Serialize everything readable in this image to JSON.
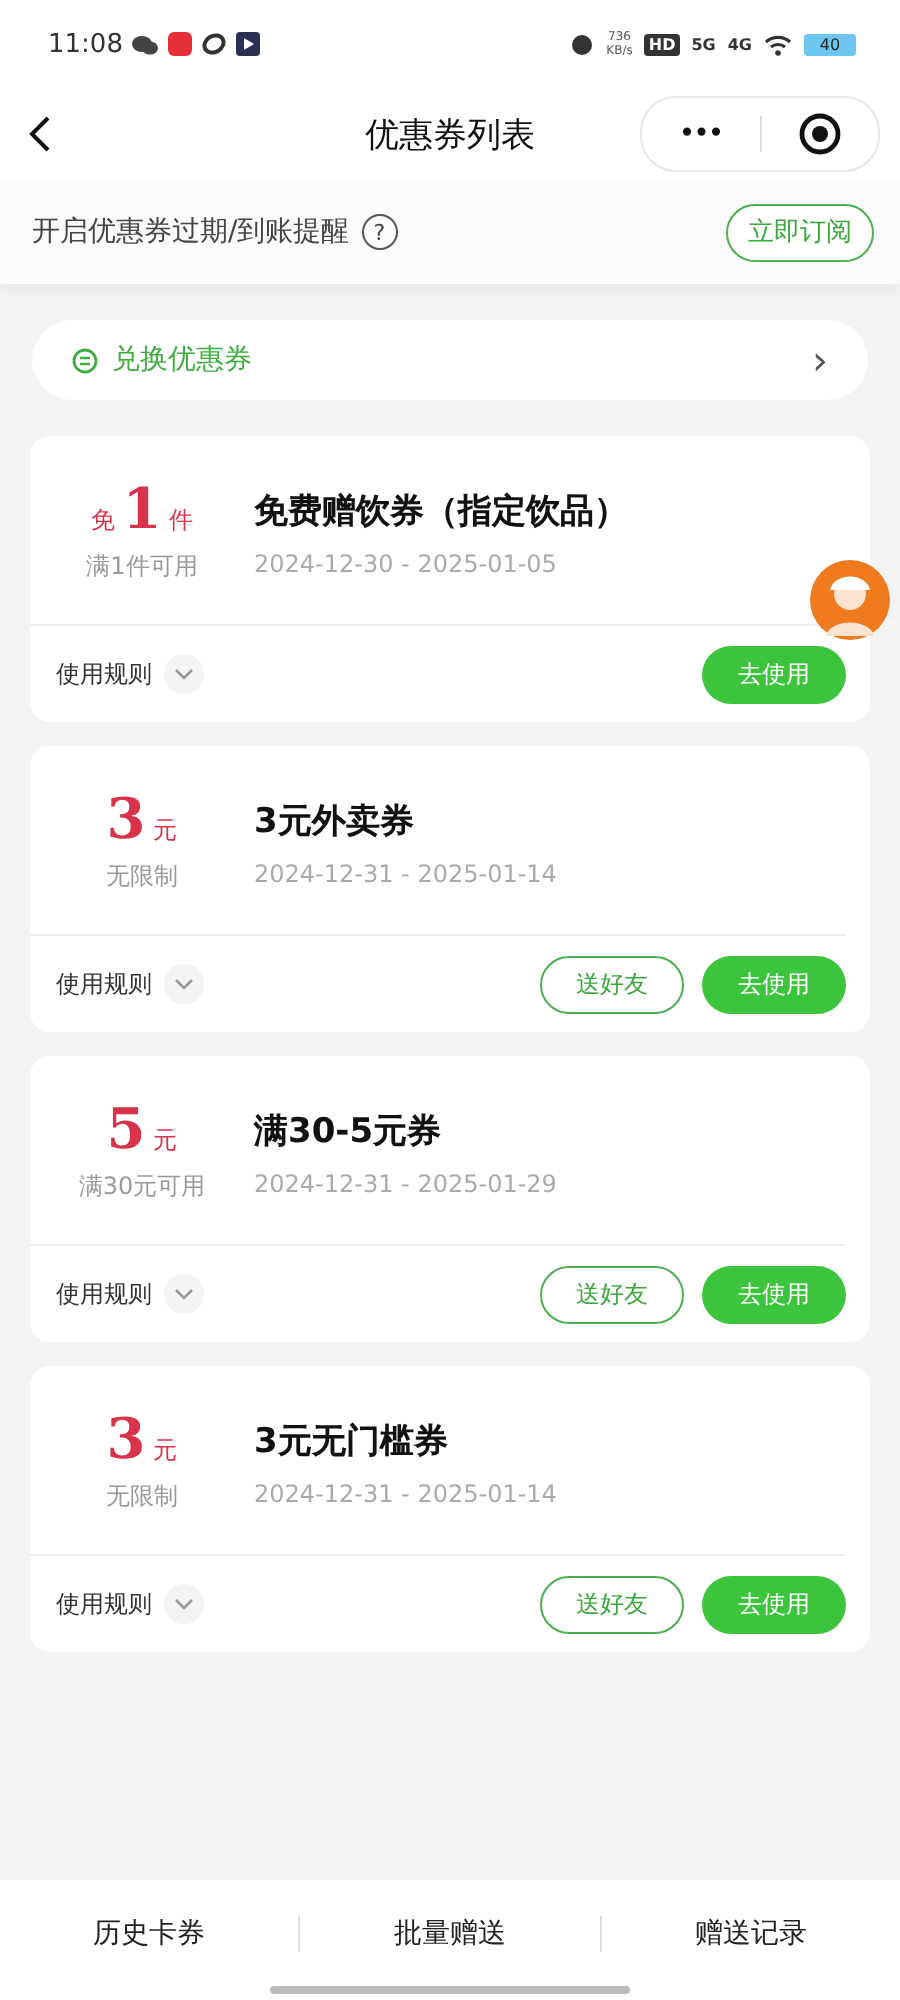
{
  "status_bar": {
    "time": "11:08",
    "speed": "736",
    "speed_unit": "KB/s",
    "hd": "HD",
    "net_5g": "5G",
    "net_4g": "4G",
    "battery": "40"
  },
  "nav": {
    "title": "优惠券列表",
    "more": "•••"
  },
  "subscribe": {
    "text": "开启优惠券过期/到账提醒",
    "help": "?",
    "button": "立即订阅"
  },
  "exchange": {
    "label": "兑换优惠券",
    "chevron": "›"
  },
  "coupons": [
    {
      "prefix": "免",
      "amount": "1",
      "unit": "件",
      "condition": "满1件可用",
      "title": "免费赠饮券（指定饮品）",
      "dates": "2024-12-30 - 2025-01-05",
      "rules": "使用规则",
      "buttons": [
        {
          "kind": "filled",
          "label": "去使用"
        }
      ]
    },
    {
      "amount": "3",
      "unit": "元",
      "condition": "无限制",
      "title": "3元外卖券",
      "dates": "2024-12-31 - 2025-01-14",
      "rules": "使用规则",
      "buttons": [
        {
          "kind": "outline",
          "label": "送好友"
        },
        {
          "kind": "filled",
          "label": "去使用"
        }
      ]
    },
    {
      "amount": "5",
      "unit": "元",
      "condition": "满30元可用",
      "title": "满30-5元券",
      "dates": "2024-12-31 - 2025-01-29",
      "rules": "使用规则",
      "buttons": [
        {
          "kind": "outline",
          "label": "送好友"
        },
        {
          "kind": "filled",
          "label": "去使用"
        }
      ]
    },
    {
      "amount": "3",
      "unit": "元",
      "condition": "无限制",
      "title": "3元无门槛券",
      "dates": "2024-12-31 - 2025-01-14",
      "rules": "使用规则",
      "buttons": [
        {
          "kind": "outline",
          "label": "送好友"
        },
        {
          "kind": "filled",
          "label": "去使用"
        }
      ]
    }
  ],
  "bottom_tabs": [
    "历史卡券",
    "批量赠送",
    "赠送记录"
  ]
}
